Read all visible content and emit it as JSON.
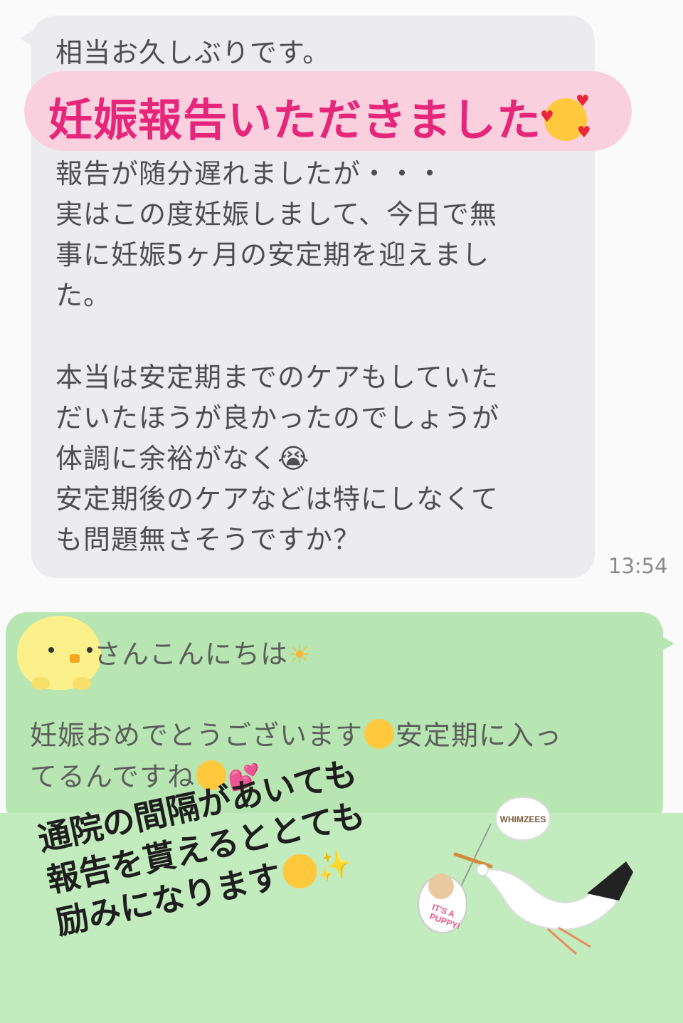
{
  "incoming": {
    "greeting": "相当お久しぶりです。",
    "paragraph1": "報告が随分遅れましたが・・・\n実はこの度妊娠しまして、今日で無\n事に妊娠5ヶ月の安定期を迎えまし\nた。",
    "paragraph2": "本当は安定期までのケアもしていた\nだいたほうが良かったのでしょうが\n体調に余裕がなく😭\n安定期後のケアなどは特にしなくて\nも問題無さそうですか？",
    "time": "13:54"
  },
  "banner": {
    "text": "妊娠報告いただきました"
  },
  "reply": {
    "greeting": "さんこんにちは",
    "line1": "妊娠おめでとうございます",
    "line1b": "安定期に入っ",
    "line2": "てるんですね"
  },
  "caption": {
    "line1": "通院の間隔があいても",
    "line2": "報告を貰えるととても",
    "line3": "励みになります"
  },
  "sticker": {
    "brand": "WHIMZEES",
    "bag_text_1": "IT'S A",
    "bag_text_2": "PUPPY!"
  },
  "colors": {
    "incoming_bubble": "#ececef",
    "outgoing_bubble": "#b8e6b2",
    "banner_bg": "#fbd0de",
    "banner_text": "#e6267a"
  }
}
